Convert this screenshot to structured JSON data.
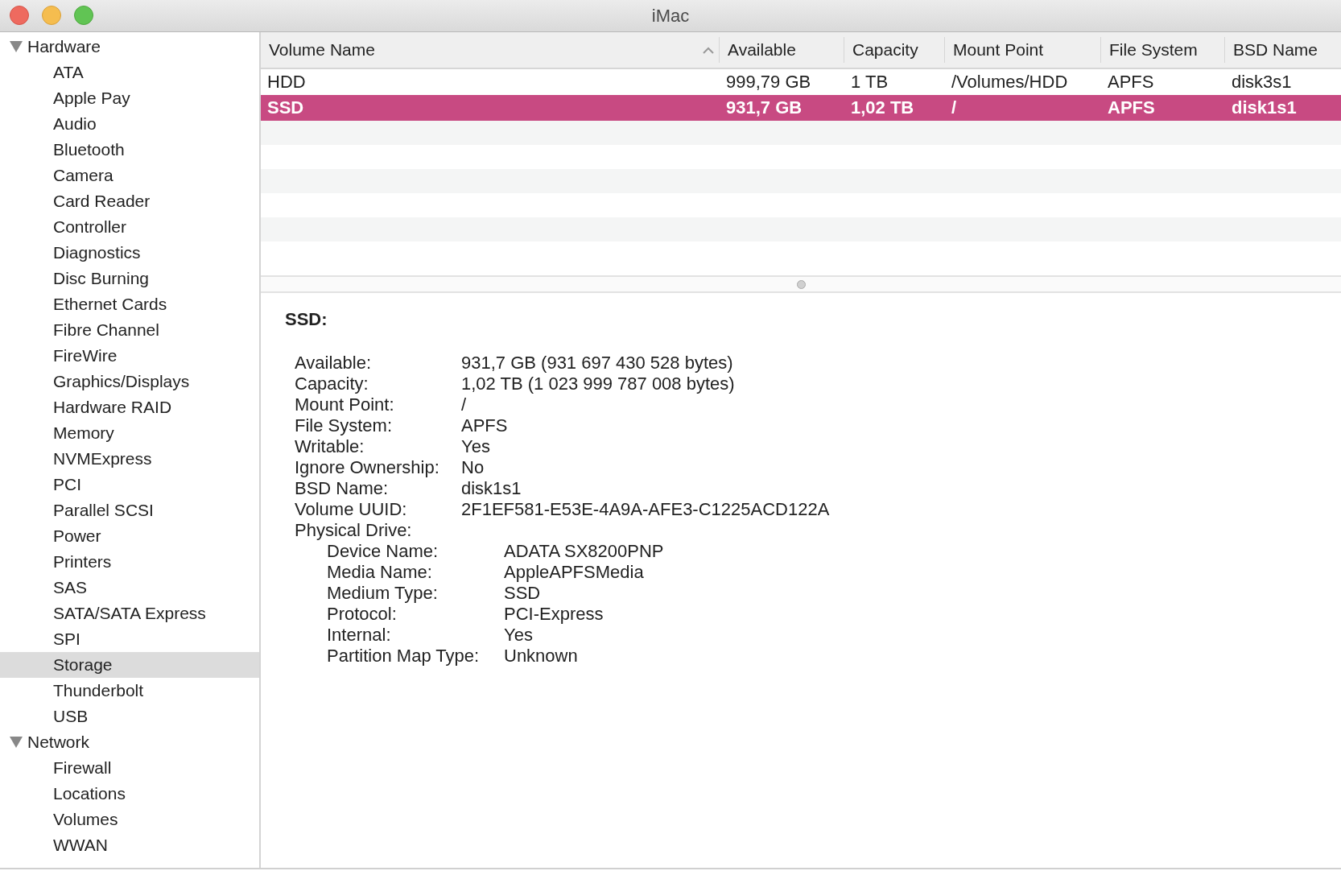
{
  "window": {
    "title": "iMac"
  },
  "sidebar": {
    "groups": [
      {
        "label": "Hardware",
        "expanded": true,
        "items": [
          {
            "label": "ATA",
            "selected": false
          },
          {
            "label": "Apple Pay",
            "selected": false
          },
          {
            "label": "Audio",
            "selected": false
          },
          {
            "label": "Bluetooth",
            "selected": false
          },
          {
            "label": "Camera",
            "selected": false
          },
          {
            "label": "Card Reader",
            "selected": false
          },
          {
            "label": "Controller",
            "selected": false
          },
          {
            "label": "Diagnostics",
            "selected": false
          },
          {
            "label": "Disc Burning",
            "selected": false
          },
          {
            "label": "Ethernet Cards",
            "selected": false
          },
          {
            "label": "Fibre Channel",
            "selected": false
          },
          {
            "label": "FireWire",
            "selected": false
          },
          {
            "label": "Graphics/Displays",
            "selected": false
          },
          {
            "label": "Hardware RAID",
            "selected": false
          },
          {
            "label": "Memory",
            "selected": false
          },
          {
            "label": "NVMExpress",
            "selected": false
          },
          {
            "label": "PCI",
            "selected": false
          },
          {
            "label": "Parallel SCSI",
            "selected": false
          },
          {
            "label": "Power",
            "selected": false
          },
          {
            "label": "Printers",
            "selected": false
          },
          {
            "label": "SAS",
            "selected": false
          },
          {
            "label": "SATA/SATA Express",
            "selected": false
          },
          {
            "label": "SPI",
            "selected": false
          },
          {
            "label": "Storage",
            "selected": true
          },
          {
            "label": "Thunderbolt",
            "selected": false
          },
          {
            "label": "USB",
            "selected": false
          }
        ]
      },
      {
        "label": "Network",
        "expanded": true,
        "items": [
          {
            "label": "Firewall",
            "selected": false
          },
          {
            "label": "Locations",
            "selected": false
          },
          {
            "label": "Volumes",
            "selected": false
          },
          {
            "label": "WWAN",
            "selected": false
          }
        ]
      }
    ]
  },
  "table": {
    "columns": [
      {
        "label": "Volume Name",
        "sorted": true
      },
      {
        "label": "Available",
        "sorted": false
      },
      {
        "label": "Capacity",
        "sorted": false
      },
      {
        "label": "Mount Point",
        "sorted": false
      },
      {
        "label": "File System",
        "sorted": false
      },
      {
        "label": "BSD Name",
        "sorted": false
      }
    ],
    "rows": [
      {
        "cells": [
          "HDD",
          "999,79 GB",
          "1 TB",
          "/Volumes/HDD",
          "APFS",
          "disk3s1"
        ],
        "selected": false
      },
      {
        "cells": [
          "SSD",
          "931,7 GB",
          "1,02 TB",
          "/",
          "APFS",
          "disk1s1"
        ],
        "selected": true
      }
    ]
  },
  "detail": {
    "title": "SSD:",
    "fields": [
      {
        "key": "Available:",
        "value": "931,7 GB (931 697 430 528 bytes)"
      },
      {
        "key": "Capacity:",
        "value": "1,02 TB (1 023 999 787 008 bytes)"
      },
      {
        "key": "Mount Point:",
        "value": "/"
      },
      {
        "key": "File System:",
        "value": "APFS"
      },
      {
        "key": "Writable:",
        "value": "Yes"
      },
      {
        "key": "Ignore Ownership:",
        "value": "No"
      },
      {
        "key": "BSD Name:",
        "value": "disk1s1"
      },
      {
        "key": "Volume UUID:",
        "value": "2F1EF581-E53E-4A9A-AFE3-C1225ACD122A"
      },
      {
        "key": "Physical Drive:",
        "children": [
          {
            "key": "Device Name:",
            "value": "ADATA SX8200PNP"
          },
          {
            "key": "Media Name:",
            "value": "AppleAPFSMedia"
          },
          {
            "key": "Medium Type:",
            "value": "SSD"
          },
          {
            "key": "Protocol:",
            "value": "PCI-Express"
          },
          {
            "key": "Internal:",
            "value": "Yes"
          },
          {
            "key": "Partition Map Type:",
            "value": "Unknown"
          }
        ]
      }
    ]
  }
}
